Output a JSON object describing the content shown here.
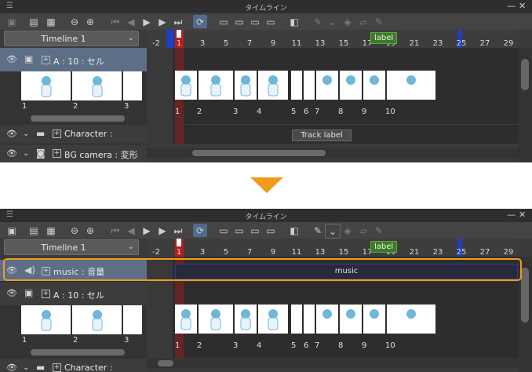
{
  "window_title": "タイムライン",
  "timeline_select": "Timeline 1",
  "ruler_ticks": [
    "-2",
    "1",
    "3",
    "5",
    "7",
    "9",
    "11",
    "13",
    "15",
    "17",
    "19",
    "21",
    "23",
    "25",
    "27",
    "29"
  ],
  "label_tag": "label",
  "layers": {
    "music": "music : 音量",
    "cel": "A : 10 : セル",
    "character": "Character :",
    "bg_camera": "BG camera : 変形"
  },
  "header_frames": [
    "1",
    "2",
    "3"
  ],
  "track_frames": [
    "1",
    "2",
    "3",
    "4",
    "5",
    "6",
    "7",
    "8",
    "9",
    "10"
  ],
  "music_clip": "music",
  "track_label": "Track label",
  "colors": {
    "accent": "#f29a1c",
    "selection": "#5d6f86",
    "label": "#3a7a2a"
  }
}
